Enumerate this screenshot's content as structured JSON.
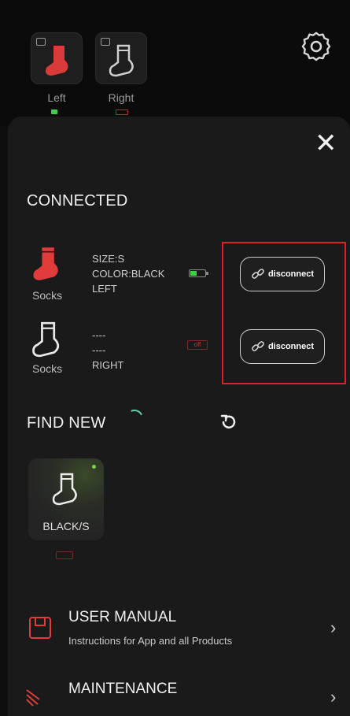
{
  "header": {
    "left_label": "Left",
    "right_label": "Right"
  },
  "connected": {
    "title": "CONNECTED",
    "devices": [
      {
        "label": "Socks",
        "lines": [
          "SIZE:S",
          "COLOR:BLACK",
          "LEFT"
        ],
        "battery": "green",
        "action": "disconnect"
      },
      {
        "label": "Socks",
        "lines": [
          "----",
          "----",
          "RIGHT"
        ],
        "battery": "off",
        "action": "disconnect"
      }
    ]
  },
  "find_new": {
    "title": "FIND NEW",
    "found": [
      {
        "label": "BLACK/S"
      }
    ]
  },
  "menu": [
    {
      "title": "USER MANUAL",
      "subtitle": "Instructions for App and all Products"
    },
    {
      "title": "MAINTENANCE"
    }
  ],
  "colors": {
    "accent_red": "#e23b3b",
    "battery_green": "#3fcf4a",
    "highlight_red": "#e01f25"
  },
  "icons": {
    "gear": "gear-icon",
    "close": "close-icon",
    "refresh": "refresh-icon",
    "sock": "sock-icon",
    "link": "link-icon"
  },
  "glyphs": {
    "close": "✕",
    "chevron": "›",
    "battery_off": "off"
  }
}
